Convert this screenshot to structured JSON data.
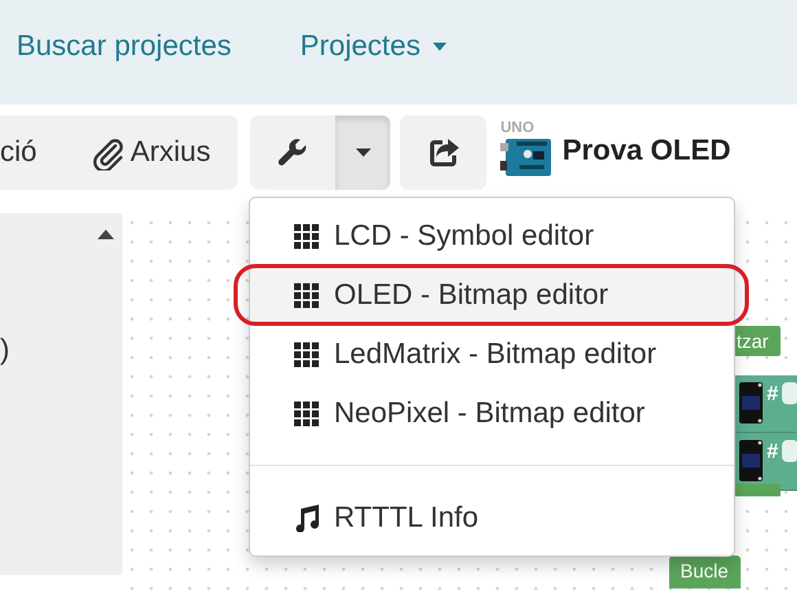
{
  "navbar": {
    "links": [
      {
        "label": "Buscar projectes",
        "kind": "link"
      },
      {
        "label": "Projectes",
        "kind": "dropdown"
      }
    ]
  },
  "toolbar": {
    "file_group": [
      {
        "label": "ció",
        "kind": "text"
      },
      {
        "label": "Arxius",
        "kind": "attach"
      }
    ],
    "tools_button": {
      "expanded": true
    },
    "board": {
      "label": "UNO"
    },
    "project_title": "Prova OLED"
  },
  "sidebar": {
    "text": ")"
  },
  "menu": {
    "sections": [
      [
        {
          "label": "LCD - Symbol editor",
          "kind": "grid",
          "selected": false,
          "circled": false
        },
        {
          "label": "OLED - Bitmap editor",
          "kind": "grid",
          "selected": true,
          "circled": true
        },
        {
          "label": "LedMatrix - Bitmap editor",
          "kind": "grid",
          "selected": false,
          "circled": false
        },
        {
          "label": "NeoPixel - Bitmap editor",
          "kind": "grid",
          "selected": false,
          "circled": false
        }
      ],
      [
        {
          "label": "RTTTL Info",
          "kind": "music",
          "selected": false,
          "circled": false
        }
      ]
    ]
  },
  "workspace": {
    "blocks": [
      {
        "kind": "header",
        "label": "tzar"
      },
      {
        "kind": "oled",
        "label": "#"
      },
      {
        "kind": "oled",
        "label": "#"
      },
      {
        "kind": "bar"
      },
      {
        "kind": "loop",
        "label": "Bucle"
      }
    ]
  }
}
